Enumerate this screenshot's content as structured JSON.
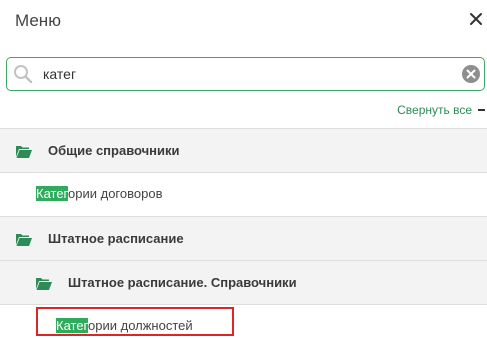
{
  "header": {
    "title": "Меню"
  },
  "search": {
    "value": "катег"
  },
  "collapse_all": {
    "label": "Свернуть все"
  },
  "tree": {
    "group1": {
      "label": "Общие справочники"
    },
    "item1": {
      "highlight": "Катег",
      "rest": "ории договоров"
    },
    "group2": {
      "label": "Штатное расписание"
    },
    "subgroup": {
      "label": "Штатное расписание. Справочники"
    },
    "item2": {
      "highlight": "Катег",
      "rest": "ории должностей"
    }
  },
  "colors": {
    "accent": "#2e8b57",
    "highlight_bg": "#2eab5c",
    "selection_border": "#d9262b"
  }
}
